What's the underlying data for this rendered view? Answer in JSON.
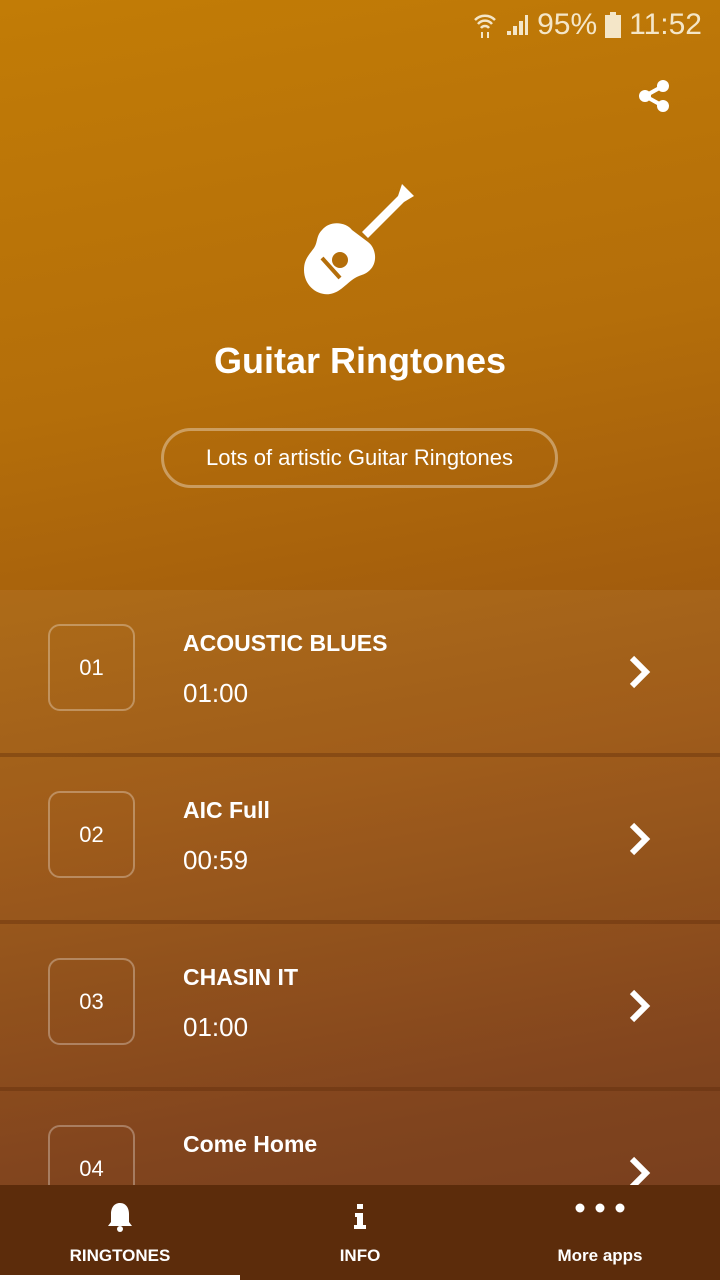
{
  "status_bar": {
    "battery": "95%",
    "time": "11:52"
  },
  "header": {
    "title": "Guitar Ringtones",
    "subtitle": "Lots of artistic Guitar Ringtones"
  },
  "ringtones": [
    {
      "number": "01",
      "name": "ACOUSTIC BLUES",
      "duration": "01:00"
    },
    {
      "number": "02",
      "name": "AIC Full",
      "duration": "00:59"
    },
    {
      "number": "03",
      "name": "CHASIN IT",
      "duration": "01:00"
    },
    {
      "number": "04",
      "name": "Come Home",
      "duration": ""
    }
  ],
  "nav": {
    "tabs": [
      {
        "label": "RINGTONES",
        "icon": "bell-icon",
        "active": true
      },
      {
        "label": "INFO",
        "icon": "info-icon"
      },
      {
        "label": "More apps",
        "icon": "more-dots-icon"
      }
    ]
  },
  "colors": {
    "bg_top": "#c27c06",
    "bg_bottom": "#6c3212",
    "nav": "#5c2c0b"
  }
}
